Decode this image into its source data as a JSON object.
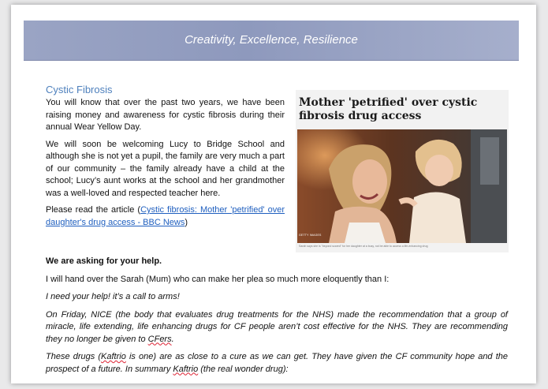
{
  "banner": {
    "text": "Creativity, Excellence, Resilience"
  },
  "section": {
    "heading": "Cystic Fibrosis"
  },
  "left": {
    "p1": "You will know that over the past two years, we have been raising money and awareness for cystic fibrosis during their annual Wear Yellow Day.",
    "p2": "We will soon be welcoming Lucy to Bridge School and although she is not yet a pupil, the family are very much a part of our community – the family already have a child at the school; Lucy’s aunt works at the school and her grandmother was a well-loved and respected teacher here.",
    "p3_prefix": "Please read the article (",
    "p3_link": "Cystic fibrosis: Mother 'petrified' over daughter's drug access - BBC News",
    "p3_suffix": ")"
  },
  "article": {
    "title": "Mother 'petrified' over cystic fibrosis drug access",
    "photo_credit": "GETTY IMAGES",
    "caption": "Sarah says she is \"beyond scared\" for her daughter at a busy, not be able to access a life-enhancing drug"
  },
  "body": {
    "asking": "We are asking for your help.",
    "handover": "I will hand over the Sarah (Mum) who can make her plea so much more eloquently than I:",
    "q1": "I need your help! it’s a call to arms!",
    "q2_a": "On Friday, NICE (the body that evaluates drug treatments for the NHS) made the recommendation that a group of miracle, life extending, life enhancing drugs for CF people aren’t cost effective for the NHS. They are recommending they no longer be given to ",
    "q2_cf": "CFers",
    "q2_end": ".",
    "q3_a": "These drugs (",
    "q3_k1": "Kaftrio",
    "q3_b": " is one) are as close to a cure as we can get. They have given the CF community hope and the prospect of a future. In summary ",
    "q3_k2": "Kaftrio",
    "q3_c": " (the real wonder drug):"
  }
}
